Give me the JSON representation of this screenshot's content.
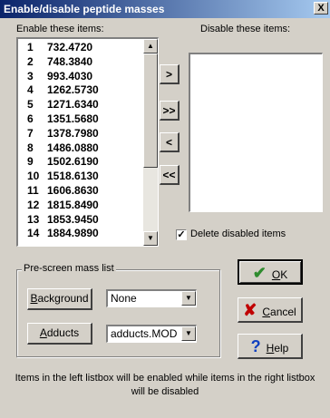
{
  "window": {
    "title": "Enable/disable peptide masses",
    "close_glyph": "X"
  },
  "enable_list": {
    "label": "Enable these items:",
    "items": [
      {
        "index": "1",
        "mass": "732.4720"
      },
      {
        "index": "2",
        "mass": "748.3840"
      },
      {
        "index": "3",
        "mass": "993.4030"
      },
      {
        "index": "4",
        "mass": "1262.5730"
      },
      {
        "index": "5",
        "mass": "1271.6340"
      },
      {
        "index": "6",
        "mass": "1351.5680"
      },
      {
        "index": "7",
        "mass": "1378.7980"
      },
      {
        "index": "8",
        "mass": "1486.0880"
      },
      {
        "index": "9",
        "mass": "1502.6190"
      },
      {
        "index": "10",
        "mass": "1518.6130"
      },
      {
        "index": "11",
        "mass": "1606.8630"
      },
      {
        "index": "12",
        "mass": "1815.8490"
      },
      {
        "index": "13",
        "mass": "1853.9450"
      },
      {
        "index": "14",
        "mass": "1884.9890"
      }
    ]
  },
  "disable_list": {
    "label": "Disable these items:",
    "items": []
  },
  "move_buttons": {
    "move_one_right": ">",
    "move_all_right": ">>",
    "move_one_left": "<",
    "move_all_left": "<<"
  },
  "delete_disabled": {
    "label": "Delete disabled items",
    "checked": true,
    "check_glyph": "✓"
  },
  "prescreen": {
    "legend": "Pre-screen mass list",
    "background_button": {
      "hotkey": "B",
      "rest": "ackground"
    },
    "background_value": "None",
    "adducts_button": {
      "hotkey": "A",
      "rest": "dducts"
    },
    "adducts_value": "adducts.MOD"
  },
  "actions": {
    "ok": {
      "hotkey": "O",
      "rest": "K",
      "icon_glyph": "✔",
      "icon_color": "#2e8b2e"
    },
    "cancel": {
      "hotkey": "C",
      "rest": "ancel",
      "icon_glyph": "✘",
      "icon_color": "#c00000"
    },
    "help": {
      "hotkey": "H",
      "rest": "elp",
      "icon_glyph": "?",
      "icon_color": "#1040c0"
    }
  },
  "footer_text": "Items in the left listbox will be enabled while items in the right listbox will be disabled"
}
